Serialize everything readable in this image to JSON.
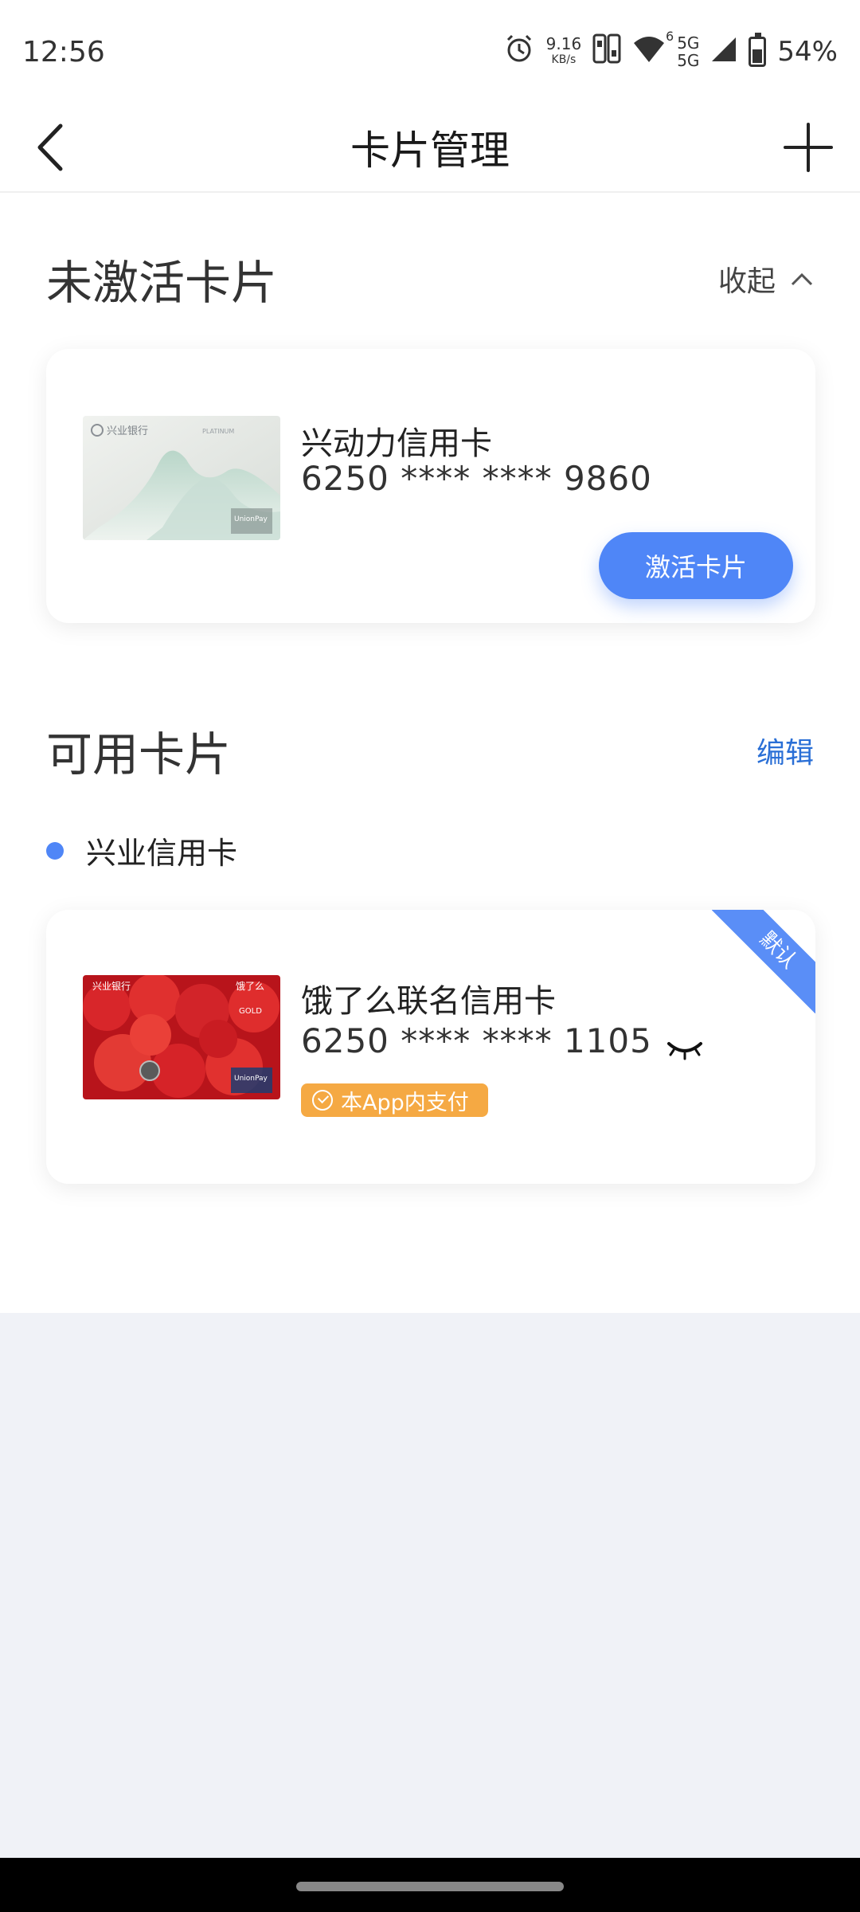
{
  "status_bar": {
    "time": "12:56",
    "speed_value": "9.16",
    "speed_unit": "KB/s",
    "wifi_label": "6",
    "network_top": "5G",
    "network_bottom": "5G",
    "battery_percent": "54%"
  },
  "nav": {
    "title": "卡片管理",
    "back_icon": "chevron-left-icon",
    "add_icon": "plus-icon"
  },
  "inactive_section": {
    "title": "未激活卡片",
    "collapse_label": "收起",
    "cards": [
      {
        "name": "兴动力信用卡",
        "number": "6250 **** **** 9860",
        "action_label": "激活卡片",
        "bank_logo_text": "兴业银行",
        "tier_text": "PLATINUM",
        "network_text": "UnionPay"
      }
    ]
  },
  "available_section": {
    "title": "可用卡片",
    "edit_label": "编辑",
    "bank_group": "兴业信用卡",
    "cards": [
      {
        "name": "饿了么联名信用卡",
        "number": "6250 **** **** 1105",
        "badge": "默认",
        "pay_label": "本App内支付",
        "bank_logo_text": "兴业银行",
        "cobrand_text": "饿了么",
        "tier_text": "GOLD",
        "network_text": "UnionPay"
      }
    ]
  },
  "colors": {
    "accent_blue": "#4f86f7",
    "link_blue": "#2a6fd6",
    "pay_orange": "#f5a943",
    "page_gray": "#f0f2f7"
  }
}
